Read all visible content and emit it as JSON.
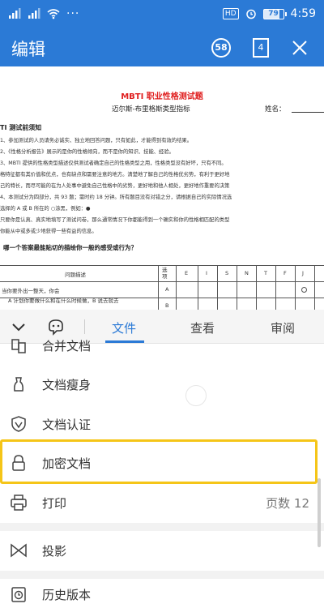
{
  "status_bar": {
    "hd": "HD",
    "battery": "79",
    "time": "4:59"
  },
  "title_bar": {
    "title": "编辑",
    "badge_count": "58",
    "page_count": "4"
  },
  "document": {
    "title": "MBTI 职业性格测试题",
    "subtitle": "迈尔斯-布里格斯类型指标",
    "name_label": "姓名：",
    "heading": "TI 测试前须知",
    "lines": [
      "1、参加测试的人员请务必诚实、独立地回答问题，只有如此，才能得到有效的结果。",
      "2、《性格分析报告》展示的是你的性格倾向，而不是你的知识、技能、经验。",
      "3、MBTI 提供的性格类型描述仅供测试者确定自己的性格类型之用，性格类型没有好坏，只有不同。",
      "格特征都有其价值和优点，也有缺点和需要注意的地方。清楚地了解自己的性格优劣势，有利于更好地",
      "己的特长，而尽可能的在为人处事中避免自己性格中的劣势，更好地和他人相处，更好地作重要的决策",
      "4、本测试分为四部分，共 93 题；需时约 18 分钟。所有题目没有对错之分，请根据自己的实际情况选",
      "选择的 A 或 B 所在的 ○涂黑，例如：●",
      "只要你是认真、真实地填写了测试问卷，那么通常情况下你都能得到一个确实和你的性格相匹配的类型",
      "你能从中或多或少地获得一些有益的信息。"
    ],
    "question": "哪一个答案最能贴切的描绘你一般的感受或行为？",
    "table": {
      "header_desc": "问题描述",
      "header_option": "选项",
      "columns": [
        "E",
        "I",
        "S",
        "N",
        "T",
        "F",
        "J"
      ],
      "row_text_1": "当你要外出一整天，你会",
      "row_text_2": "A 计划你要做什么和在什么时候做，B 说去就去",
      "row_a": "A",
      "row_b": "B"
    }
  },
  "toolbar": {
    "tabs": [
      "文件",
      "查看",
      "审阅"
    ],
    "active_tab": "文件"
  },
  "menu": {
    "items": [
      {
        "label": "合并文档",
        "icon": "merge-icon"
      },
      {
        "label": "文档瘦身",
        "icon": "slim-icon"
      },
      {
        "label": "文档认证",
        "icon": "certify-icon"
      },
      {
        "label": "加密文档",
        "icon": "lock-icon"
      },
      {
        "label": "打印",
        "icon": "print-icon",
        "extra": "页数 12"
      },
      {
        "label": "投影",
        "icon": "projection-icon"
      },
      {
        "label": "历史版本",
        "icon": "history-icon"
      }
    ]
  },
  "colors": {
    "accent": "#2b7ad6",
    "highlight": "#f5c518",
    "doc_title": "#e02020"
  }
}
